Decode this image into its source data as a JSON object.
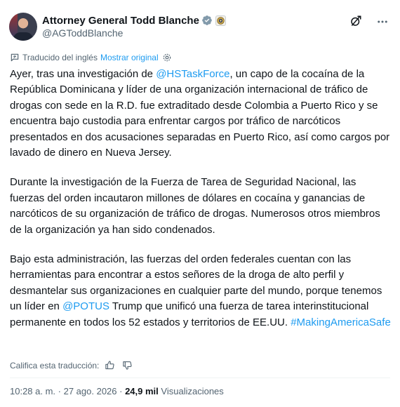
{
  "author": {
    "display_name": "Attorney General Todd Blanche",
    "handle": "@AGToddBlanche",
    "avatar_icon": "profile-photo",
    "verified_icon": "verified-badge-icon",
    "affiliation_icon": "doj-seal-icon"
  },
  "header_actions": {
    "grok_icon": "grok-icon",
    "more_icon": "more-icon"
  },
  "translation": {
    "label": "Traducido del inglés",
    "show_original": "Mostrar original"
  },
  "tweet": {
    "p1": {
      "t1": "Ayer, tras una investigación de ",
      "mention": "@HSTaskForce",
      "t2": ", un capo de la cocaína de la República Dominicana y líder de una organización internacional de tráfico de drogas con sede en la R.D. fue extraditado desde Colombia a Puerto Rico y se encuentra bajo custodia para enfrentar cargos por tráfico de narcóticos presentados en dos acusaciones separadas en Puerto Rico, así como cargos por lavado de dinero en Nueva Jersey."
    },
    "p2": "Durante la investigación de la Fuerza de Tarea de Seguridad Nacional, las fuerzas del orden incautaron millones de dólares en cocaína y ganancias de narcóticos de su organización de tráfico de drogas. Numerosos otros miembros de la organización ya han sido condenados.",
    "p3": {
      "t1": "Bajo esta administración, las fuerzas del orden federales cuentan con las herramientas para encontrar a estos señores de la droga de alto perfil y desmantelar sus organizaciones en cualquier parte del mundo, porque tenemos un líder en ",
      "mention": "@POTUS",
      "t2": " Trump que unificó una fuerza de tarea interinstitucional permanente en todos los 52 estados y territorios de EE.UU. ",
      "hashtag": "#MakingAmericaSafe"
    }
  },
  "rate_translation": {
    "label": "Califica esta traducción:"
  },
  "meta": {
    "time": "10:28 a. m.",
    "separator": " · ",
    "date": "27 ago. 2026",
    "views_count": "24,9 mil",
    "views_label": "Visualizaciones"
  },
  "colors": {
    "link": "#1d9bf0",
    "text": "#0f1419",
    "secondary": "#536471",
    "verified": "#829aab"
  }
}
